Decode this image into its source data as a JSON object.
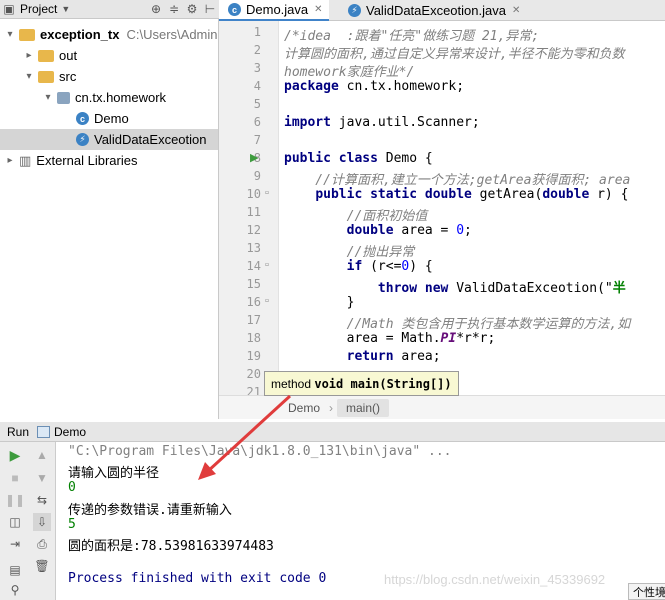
{
  "project_panel": {
    "title": "Project",
    "tree": [
      {
        "label": "exception_tx",
        "hint": "C:\\Users\\Admin",
        "indent": 0,
        "icon": "folder-icon",
        "expanded": true
      },
      {
        "label": "out",
        "indent": 1,
        "icon": "folder-icon",
        "expanded": false
      },
      {
        "label": "src",
        "indent": 1,
        "icon": "folder-icon",
        "expanded": true
      },
      {
        "label": "cn.tx.homework",
        "indent": 2,
        "icon": "package-icon",
        "expanded": true
      },
      {
        "label": "Demo",
        "indent": 3,
        "icon": "class-icon"
      },
      {
        "label": "ValidDataExceotion",
        "indent": 3,
        "icon": "exception-class-icon",
        "selected": true
      },
      {
        "label": "External Libraries",
        "indent": 0,
        "icon": "library-icon",
        "expanded": false
      }
    ]
  },
  "editor": {
    "tabs": [
      {
        "label": "Demo.java",
        "active": true
      },
      {
        "label": "ValidDataExceotion.java",
        "active": false
      }
    ],
    "line_numbers": [
      "1",
      "2",
      "3",
      "4",
      "5",
      "6",
      "7",
      "8",
      "9",
      "10",
      "11",
      "12",
      "13",
      "14",
      "15",
      "16",
      "17",
      "18",
      "19",
      "20",
      "21"
    ],
    "code_lines": [
      [
        {
          "t": "/*idea  :跟着\"任亮\"做练习题 21,异常;",
          "c": "cm"
        }
      ],
      [
        {
          "t": "计算圆的面积,通过自定义异常来设计,半径不能为零和负数",
          "c": "cm"
        }
      ],
      [
        {
          "t": "homework家庭作业*/",
          "c": "cm"
        }
      ],
      [
        {
          "t": "package",
          "c": "kw"
        },
        {
          "t": " cn.tx.homework;",
          "c": ""
        }
      ],
      [],
      [
        {
          "t": "import",
          "c": "kw"
        },
        {
          "t": " java.util.Scanner;",
          "c": ""
        }
      ],
      [],
      [
        {
          "t": "public class",
          "c": "kw"
        },
        {
          "t": " Demo {",
          "c": ""
        }
      ],
      [
        {
          "t": "    //计算面积,建立一个方法;getArea获得面积; area",
          "c": "cm"
        }
      ],
      [
        {
          "t": "    ",
          "c": ""
        },
        {
          "t": "public static double",
          "c": "kw"
        },
        {
          "t": " getArea(",
          "c": ""
        },
        {
          "t": "double",
          "c": "kw"
        },
        {
          "t": " r) {",
          "c": ""
        }
      ],
      [
        {
          "t": "        //面积初始值",
          "c": "cm"
        }
      ],
      [
        {
          "t": "        ",
          "c": ""
        },
        {
          "t": "double",
          "c": "kw"
        },
        {
          "t": " area = ",
          "c": ""
        },
        {
          "t": "0",
          "c": "num"
        },
        {
          "t": ";",
          "c": ""
        }
      ],
      [
        {
          "t": "        //抛出异常",
          "c": "cm"
        }
      ],
      [
        {
          "t": "        ",
          "c": ""
        },
        {
          "t": "if",
          "c": "kw"
        },
        {
          "t": " (r<=",
          "c": ""
        },
        {
          "t": "0",
          "c": "num"
        },
        {
          "t": ") {",
          "c": ""
        }
      ],
      [
        {
          "t": "            ",
          "c": ""
        },
        {
          "t": "throw new",
          "c": "kw"
        },
        {
          "t": " ValidDataExceotion(\"",
          "c": ""
        },
        {
          "t": "半",
          "c": "str"
        }
      ],
      [
        {
          "t": "        }",
          "c": ""
        }
      ],
      [
        {
          "t": "        //Math 类包含用于执行基本数学运算的方法,如",
          "c": "cm"
        }
      ],
      [
        {
          "t": "        area = Math.",
          "c": ""
        },
        {
          "t": "PI",
          "c": "fn"
        },
        {
          "t": "*r*r;",
          "c": ""
        }
      ],
      [
        {
          "t": "        ",
          "c": ""
        },
        {
          "t": "return",
          "c": "kw"
        },
        {
          "t": " area;",
          "c": ""
        }
      ],
      [],
      []
    ],
    "breadcrumbs": [
      "Demo",
      "main()"
    ],
    "tooltip": {
      "prefix": "method ",
      "bold": "void main(String[])"
    }
  },
  "run_panel": {
    "label": "Run",
    "config": "Demo",
    "console": [
      {
        "text": "\"C:\\Program Files\\Java\\jdk1.8.0_131\\bin\\java\" ...",
        "color": "#808080"
      },
      {
        "text": "请输入圆的半径",
        "color": "#000000"
      },
      {
        "text": "0",
        "color": "#008000"
      },
      {
        "text": "传递的参数错误.请重新输入",
        "color": "#000000"
      },
      {
        "text": "5",
        "color": "#008000"
      },
      {
        "text": "圆的面积是:78.53981633974483",
        "color": "#000000"
      },
      {
        "text": "",
        "color": "#000000"
      },
      {
        "text": "Process finished with exit code 0",
        "color": "#000080"
      }
    ]
  },
  "watermark": "https://blog.csdn.net/weixin_45339692",
  "corner_label": "个性境",
  "colors": {
    "folder": "#e8b74b",
    "package": "#8aa4bf",
    "class": "#3b82c4",
    "arrow": "#e03c3c",
    "run": "#3d9b3d"
  }
}
